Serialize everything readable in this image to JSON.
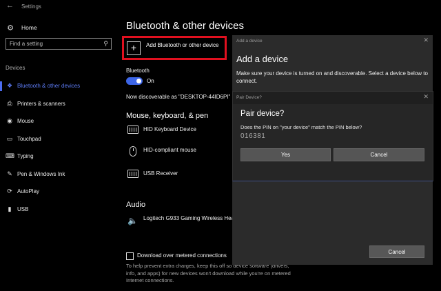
{
  "window": {
    "title": "Settings",
    "back_icon": "back-arrow-icon"
  },
  "sidebar": {
    "home_label": "Home",
    "search_placeholder": "Find a setting",
    "section_label": "Devices",
    "items": [
      {
        "label": "Bluetooth & other devices",
        "icon": "bluetooth-icon",
        "active": true
      },
      {
        "label": "Printers & scanners",
        "icon": "printer-icon"
      },
      {
        "label": "Mouse",
        "icon": "mouse-icon"
      },
      {
        "label": "Touchpad",
        "icon": "touchpad-icon"
      },
      {
        "label": "Typing",
        "icon": "keyboard-icon"
      },
      {
        "label": "Pen & Windows Ink",
        "icon": "pen-icon"
      },
      {
        "label": "AutoPlay",
        "icon": "autoplay-icon"
      },
      {
        "label": "USB",
        "icon": "usb-icon"
      }
    ]
  },
  "main": {
    "title": "Bluetooth & other devices",
    "add_device_label": "Add Bluetooth or other device",
    "bluetooth_label": "Bluetooth",
    "toggle_state": "On",
    "discoverable_text": "Now discoverable as \"DESKTOP-44ID6PI\"",
    "mouse_section_title": "Mouse, keyboard, & pen",
    "devices": [
      {
        "label": "HID Keyboard Device",
        "icon": "keyboard-icon"
      },
      {
        "label": "HID-compliant mouse",
        "icon": "mouse-icon"
      },
      {
        "label": "USB Receiver",
        "icon": "keyboard-icon"
      }
    ],
    "audio_section_title": "Audio",
    "audio_device": "Logitech G933 Gaming Wireless Hea",
    "metered_label": "Download over metered connections",
    "metered_desc": "To help prevent extra charges, keep this off so device software (drivers, info, and apps) for new devices won't download while you're on metered Internet connections."
  },
  "add_dialog": {
    "caption": "Add a device",
    "title": "Add a device",
    "description": "Make sure your device is turned on and discoverable. Select a device below to connect.",
    "cancel_label": "Cancel"
  },
  "pair_dialog": {
    "caption": "Pair Device?",
    "title": "Pair device?",
    "message": "Does the PIN on \"your device\" match the PIN below?",
    "pin": "016381",
    "yes_label": "Yes",
    "cancel_label": "Cancel"
  },
  "colors": {
    "accent": "#4b6bf0",
    "highlight_border": "#e1101f",
    "background": "#000000",
    "dialog_bg": "#2b2b2b"
  }
}
